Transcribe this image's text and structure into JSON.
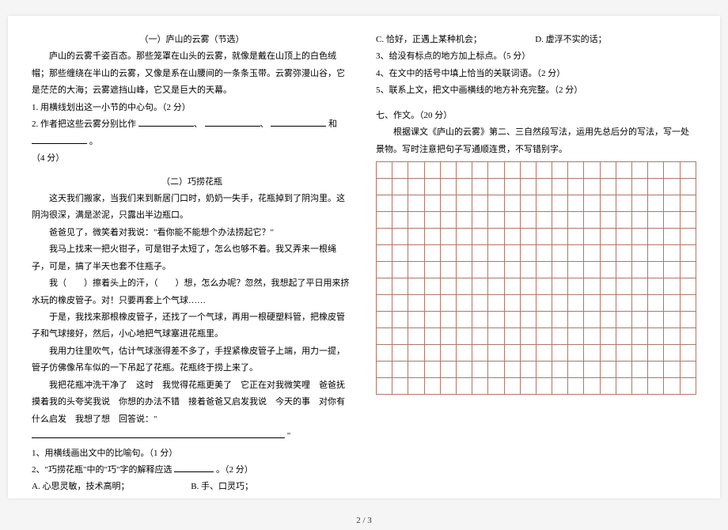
{
  "col1": {
    "title1": "（一）庐山的云雾（节选）",
    "p1": "庐山的云雾千姿百态。那些笼罩在山头的云雾，就像是戴在山顶上的白色绒帽；那些缠绕在半山的云雾，又像是系在山腰间的一条条玉带。云雾弥漫山谷，它是茫茫的大海；云雾遮挡山峰，它又是巨大的天幕。",
    "q1": "1. 用横线划出这一小节的中心句。（2 分）",
    "q2a": "2. 作者把这些云雾分别比作",
    "q2b": "和",
    "q2c": "。",
    "q2d": "（4 分）",
    "title2": "（二）巧捞花瓶",
    "p2": "这天我们搬家，当我们来到新居门口时，奶奶一失手，花瓶掉到了阴沟里。这阴沟很深，满是淤泥，只露出半边瓶口。",
    "p3": "爸爸见了，微笑着对我说：\"看你能不能想个办法捞起它？\"",
    "p4": "我马上找来一把火钳子，可是钳子太短了，怎么也够不着。我又弄来一根绳子，可是，搞了半天也套不住瓶子。",
    "p5": "我（　　）擦着头上的汗，（　　）想，怎么办呢？忽然，我想起了平日用来挤水玩的橡皮管子。对！只要再套上个气球……",
    "p6": "于是，我找来那根橡皮管子，还找了一个气球，再用一根硬塑料管，把橡皮管子和气球接好，然后，小心地把气球塞进花瓶里。",
    "p7": "我用力往里吹气，估计气球涨得差不多了，手捏紧橡皮管子上端，用力一提，管子仿佛像吊车似的一下吊起了花瓶。花瓶终于捞上来了。",
    "p8a": "我把花瓶冲洗干净了　这时　我觉得花瓶更美了　它正在对我微笑哩　爸爸抚摸着我的头夸奖我说　你想的办法不错　接着爸爸又启发我说　今天的事　对你有什么启发　我想了想　回答说：\"",
    "p8b": "\"",
    "q3": "1、用横线画出文中的比喻句。（1 分）"
  },
  "col2": {
    "q4a": "2、\"巧捞花瓶\"中的\"巧\"字的解释应选",
    "q4b": "。（2 分）",
    "optA": "A. 心思灵敏，技术高明；",
    "optB": "B. 手、口灵巧；",
    "optC": "C. 恰好，正遇上某种机会；",
    "optD": "D. 虚浮不实的话；",
    "q5": "3、给没有标点的地方加上标点。（5 分）",
    "q6": "4、在文中的括号中填上恰当的关联词语。（2 分）",
    "q7": "5、联系上文，把文中画横线的地方补充完整。（2 分）",
    "sec7": "七、作文。（20 分）",
    "sec7p": "根据课文《庐山的云雾》第二、三自然段写法，运用先总后分的写法，写一处景物。写时注意把句子写通顺连贯，不写错别字。"
  },
  "footer": "2 / 3"
}
